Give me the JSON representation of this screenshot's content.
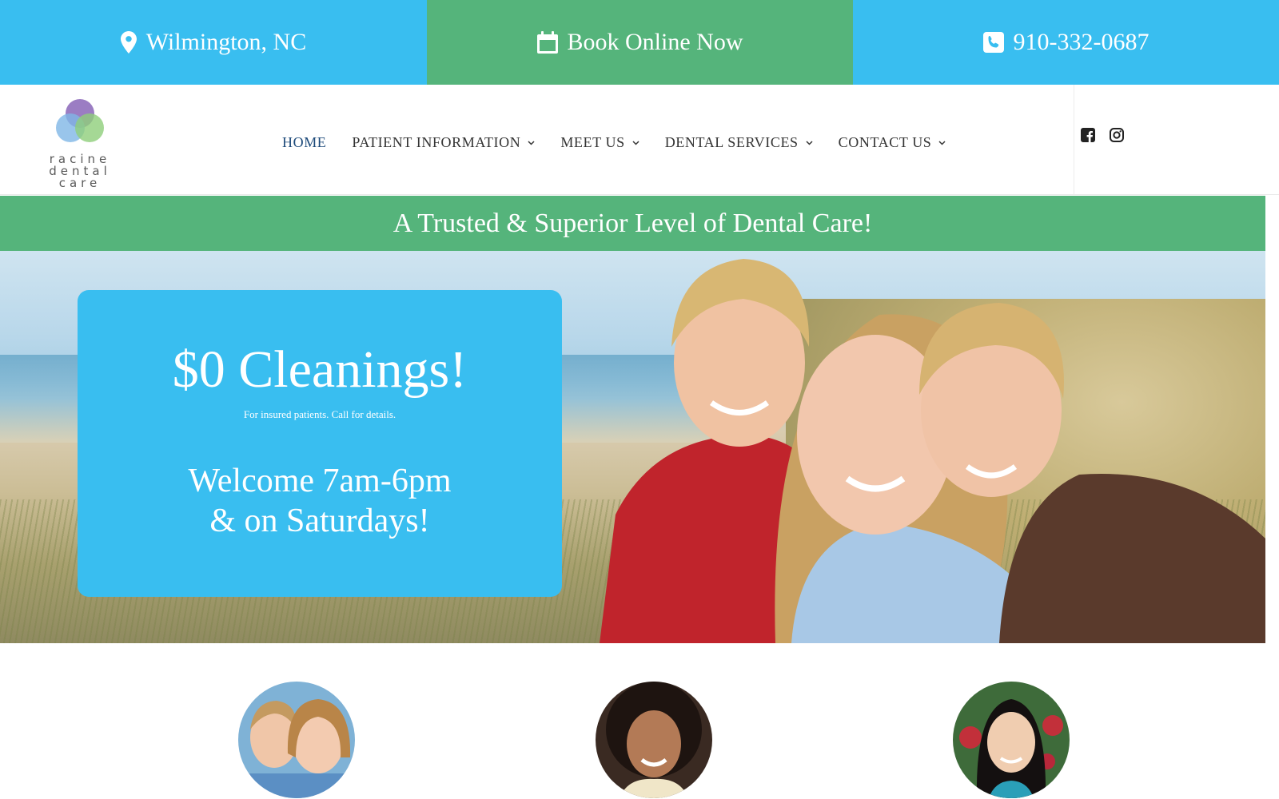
{
  "topbar": {
    "location": "Wilmington, NC",
    "book": "Book Online Now",
    "phone": "910-332-0687"
  },
  "logo": {
    "line1": "racine",
    "line2": "dental",
    "line3": "care"
  },
  "nav": {
    "items": [
      {
        "label": "HOME",
        "active": true,
        "dropdown": false
      },
      {
        "label": "PATIENT INFORMATION",
        "active": false,
        "dropdown": true
      },
      {
        "label": "MEET US",
        "active": false,
        "dropdown": true
      },
      {
        "label": "DENTAL SERVICES",
        "active": false,
        "dropdown": true
      },
      {
        "label": "CONTACT US",
        "active": false,
        "dropdown": true
      }
    ]
  },
  "social": {
    "icons": [
      "facebook-icon",
      "instagram-icon"
    ]
  },
  "banner": {
    "text": "A Trusted & Superior Level of Dental Care!"
  },
  "promo": {
    "title": "$0 Cleanings!",
    "subtitle": "For insured patients. Call for details.",
    "welcome_line1": "Welcome 7am-6pm",
    "welcome_line2": "& on Saturdays!"
  },
  "colors": {
    "blue": "#39bef0",
    "green": "#55b47b",
    "nav_active": "#1d4a7a",
    "nav_text": "#333333"
  }
}
